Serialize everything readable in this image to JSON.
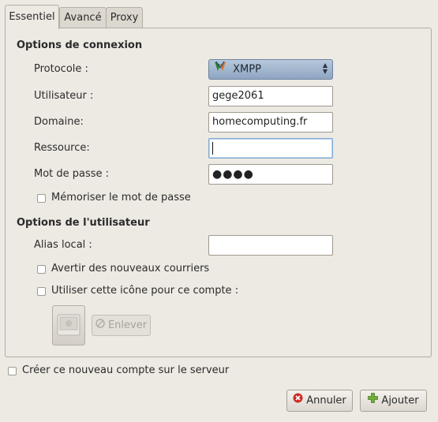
{
  "tabs": [
    {
      "label": "Essentiel"
    },
    {
      "label": "Avancé"
    },
    {
      "label": "Proxy"
    }
  ],
  "connection": {
    "title": "Options de connexion",
    "protocol_label": "Protocole :",
    "protocol_value": "XMPP",
    "user_label": "Utilisateur :",
    "user_value": "gege2061",
    "domain_label": "Domaine:",
    "domain_value": "homecomputing.fr",
    "resource_label": "Ressource:",
    "resource_value": "",
    "password_label": "Mot de passe :",
    "password_value": "●●●●",
    "remember_label": "Mémoriser le mot de passe",
    "remember_checked": false
  },
  "user_options": {
    "title": "Options de l'utilisateur",
    "alias_label": "Alias local :",
    "alias_value": "",
    "notify_label": "Avertir des nouveaux courriers",
    "notify_checked": false,
    "icon_label": "Utiliser cette icône pour ce compte :",
    "icon_checked": false,
    "remove_label": "Enlever"
  },
  "create_account_label": "Créer ce nouveau compte sur le serveur",
  "create_account_checked": false,
  "buttons": {
    "cancel": "Annuler",
    "add": "Ajouter"
  },
  "colors": {
    "window_bg": "#ede9e3",
    "combo_accent": "#8ea5c1",
    "focus_border": "#7fa9d2"
  },
  "icons": {
    "protocol": "xmpp-logo-icon",
    "remove": "no-entry-icon",
    "cancel": "cancel-icon",
    "add": "plus-icon",
    "combo_arrows": "up-down-arrows-icon",
    "account_image": "account-image-placeholder-icon"
  }
}
